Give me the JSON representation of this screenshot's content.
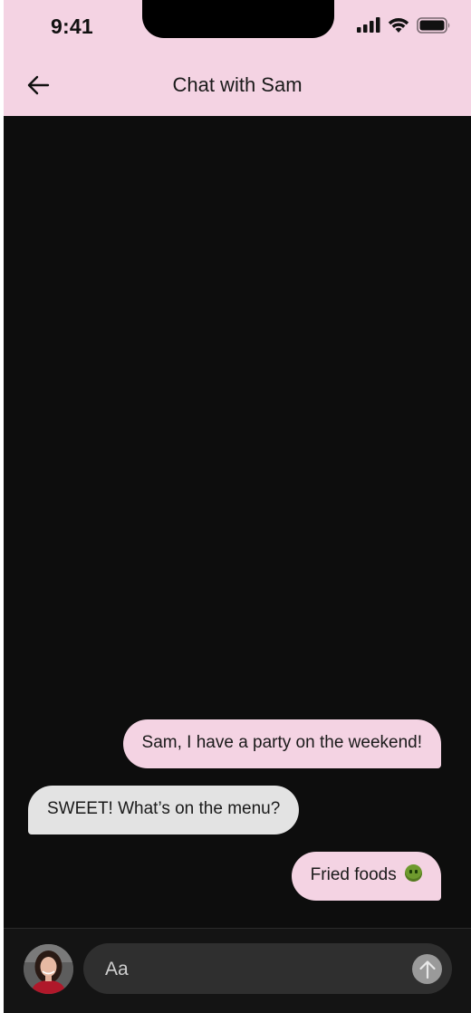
{
  "status_bar": {
    "time": "9:41",
    "icons": [
      "signal-icon",
      "wifi-icon",
      "battery-icon"
    ]
  },
  "header": {
    "title": "Chat with Sam",
    "back_icon": "arrow-left-icon"
  },
  "messages": [
    {
      "sender": "me",
      "text": "Sam, I have a party on the weekend!"
    },
    {
      "sender": "Sam",
      "text": "SWEET! What’s on the menu?"
    },
    {
      "sender": "me",
      "text": "Fried foods",
      "emoji": "nauseated-face-emoji"
    }
  ],
  "composer": {
    "placeholder": "Aa",
    "value": "",
    "send_icon": "arrow-up-icon"
  },
  "colors": {
    "header_bg": "#f4d3e3",
    "chat_bg": "#0d0d0d",
    "sent_bubble": "#f4d3e3",
    "received_bubble": "#e3e3e3",
    "composer_bg": "#2f2f2f",
    "send_button": "#9a9a9a"
  }
}
